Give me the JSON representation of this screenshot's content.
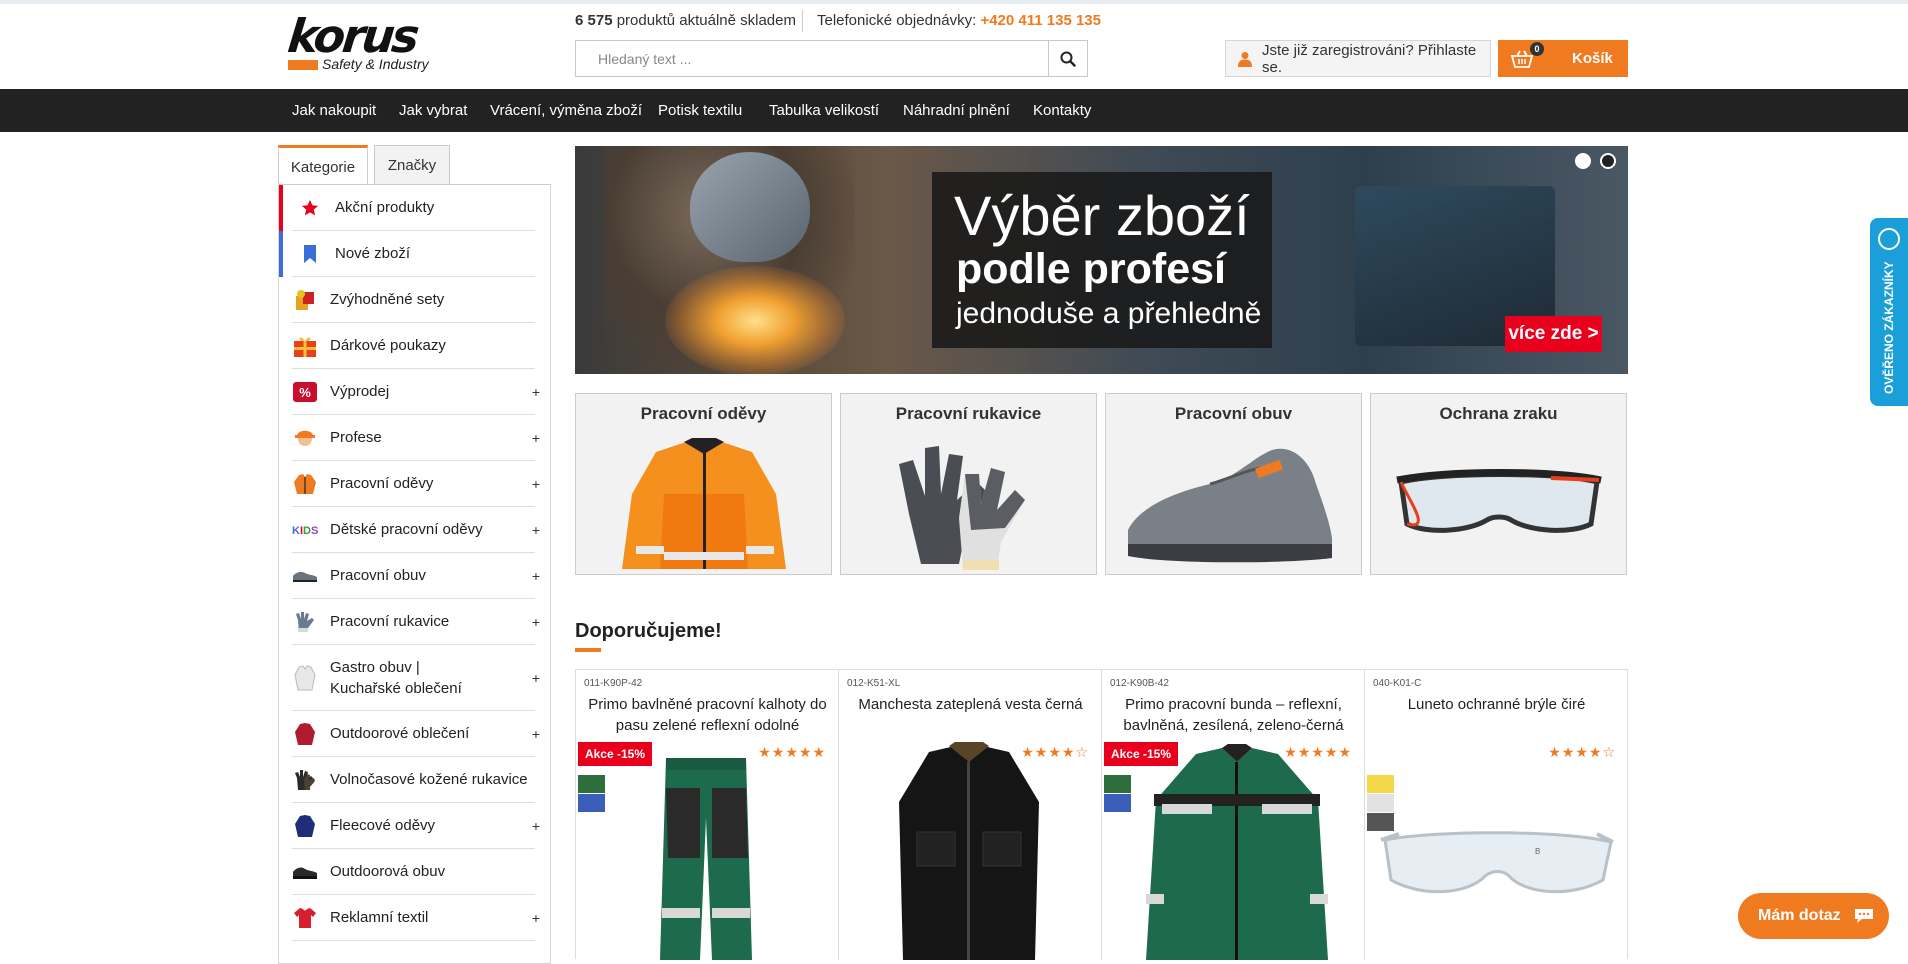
{
  "header": {
    "logo": {
      "word": "korus",
      "sub": "Safety & Industry"
    },
    "stock": {
      "count": "6 575",
      "text": " produktů aktuálně skladem"
    },
    "phone": {
      "label": "Telefonické objednávky: ",
      "number": "+420 411 135 135"
    },
    "search": {
      "placeholder": "Hledaný text ...",
      "icon": "search-icon"
    },
    "login_label": "Jste již zaregistrováni? Přihlaste se.",
    "cart": {
      "label": "Košík",
      "count": "0"
    }
  },
  "nav": {
    "items": [
      "Jak nakoupit",
      "Jak vybrat",
      "Vrácení, výměna zboží",
      "Potisk textilu",
      "Tabulka velikostí",
      "Náhradní plnění",
      "Kontakty"
    ]
  },
  "sidebar": {
    "tabs": [
      "Kategorie",
      "Značky"
    ],
    "items": [
      {
        "label": "Akční produkty",
        "icon": "star-icon"
      },
      {
        "label": "Nové zboží",
        "icon": "bookmark-icon"
      },
      {
        "label": "Zvýhodněné sety",
        "icon": "set-icon"
      },
      {
        "label": "Dárkové poukazy",
        "icon": "gift-icon"
      },
      {
        "label": "Výprodej",
        "icon": "sale-icon",
        "expand": "+"
      },
      {
        "label": "Profese",
        "icon": "worker-icon",
        "expand": "+"
      },
      {
        "label": "Pracovní oděvy",
        "icon": "jacket-icon",
        "expand": "+"
      },
      {
        "label": "Dětské pracovní oděvy",
        "icon": "kids-icon",
        "expand": "+",
        "kids_text": "KIDS"
      },
      {
        "label": "Pracovní obuv",
        "icon": "shoe-icon",
        "expand": "+"
      },
      {
        "label": "Pracovní rukavice",
        "icon": "glove-icon",
        "expand": "+"
      },
      {
        "label": "Gastro obuv | Kuchařské oblečení",
        "icon": "chef-icon",
        "expand": "+"
      },
      {
        "label": "Outdoorové oblečení",
        "icon": "outdoor-jacket-icon",
        "expand": "+"
      },
      {
        "label": "Volnočasové kožené rukavice",
        "icon": "leather-glove-icon"
      },
      {
        "label": "Fleecové oděvy",
        "icon": "fleece-icon",
        "expand": "+"
      },
      {
        "label": "Outdoorová obuv",
        "icon": "boot-icon"
      },
      {
        "label": "Reklamní textil",
        "icon": "tshirt-icon",
        "expand": "+"
      }
    ]
  },
  "banner": {
    "line1": "Výběr zboží",
    "line2": "podle profesí",
    "line3": "jednoduše a přehledně",
    "cta": "více zde >"
  },
  "categories": [
    {
      "title": "Pracovní oděvy",
      "icon": "reflective-jacket-icon"
    },
    {
      "title": "Pracovní rukavice",
      "icon": "work-glove-icon"
    },
    {
      "title": "Pracovní obuv",
      "icon": "work-shoe-icon"
    },
    {
      "title": "Ochrana zraku",
      "icon": "safety-glasses-icon"
    }
  ],
  "recommend": {
    "title": "Doporučujeme!",
    "products": [
      {
        "code": "011-K90P-42",
        "name": "Primo bavlněné pracovní kalhoty do pasu zelené reflexní odolné",
        "badge": "Akce -15%",
        "stars": "★★★★★",
        "swatches": [
          "#2e6e3c",
          "#3b5fb8"
        ]
      },
      {
        "code": "012-K51-XL",
        "name": "Manchesta zateplená vesta černá",
        "badge": "",
        "stars": "★★★★☆",
        "swatches": []
      },
      {
        "code": "012-K90B-42",
        "name": "Primo pracovní bunda – reflexní, bavlněná, zesílená, zeleno-černá",
        "badge": "Akce -15%",
        "stars": "★★★★★",
        "swatches": [
          "#2e6e3c",
          "#3b5fb8"
        ]
      },
      {
        "code": "040-K01-C",
        "name": "Luneto ochranné brýle čiré",
        "badge": "",
        "stars": "★★★★☆",
        "swatches": [
          "#f5d84a",
          "#e2e2e2",
          "#555555"
        ]
      }
    ]
  },
  "widgets": {
    "verified": "OVĚŘENO ZÁKAZNÍKY",
    "chat": "Mám dotaz"
  },
  "colors": {
    "accent": "#f07a20",
    "nav_bg": "#222222",
    "sale_red": "#e8001c",
    "verified_blue": "#1a9fd8"
  }
}
